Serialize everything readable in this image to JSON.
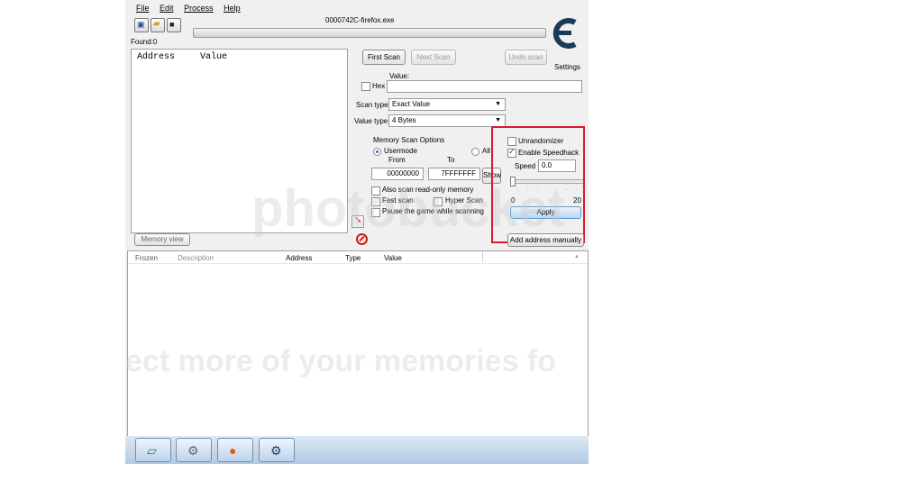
{
  "menu": [
    "File",
    "Edit",
    "Process",
    "Help"
  ],
  "process_title": "0000742C-firefox.exe",
  "found_label": "Found:0",
  "results_list": {
    "headers": [
      "Address",
      "Value"
    ]
  },
  "buttons": {
    "first_scan": "First Scan",
    "next_scan": "Next Scan",
    "undo_scan": "Undo scan",
    "memory_view": "Memory view",
    "show": "Show",
    "apply": "Apply",
    "add_address": "Add address manually"
  },
  "settings_label": "Settings",
  "value_label": "Value:",
  "hex_label": "Hex",
  "scan_type": {
    "label": "Scan type",
    "value": "Exact Value"
  },
  "value_type": {
    "label": "Value type",
    "value": "4 Bytes"
  },
  "memory_scan": {
    "title": "Memory Scan Options",
    "usermode": "Usermode",
    "all": "All",
    "from_label": "From",
    "to_label": "To",
    "from_value": "00000000",
    "to_value": "7FFFFFFF",
    "readonly": "Also scan read-only memory",
    "fast_scan": "Fast scan",
    "hyper_scan": "Hyper Scan",
    "pause": "Pause the game while scanning"
  },
  "speedhack": {
    "unrandomizer": "Unrandomizer",
    "enable": "Enable Speedhack",
    "enabled": true,
    "speed_label": "Speed",
    "speed_value": "0.0",
    "slider_min": "0",
    "slider_max": "20",
    "slider_value": 0
  },
  "address_table": {
    "headers": [
      "Frozen",
      "Description",
      "Address",
      "Type",
      "Value"
    ]
  },
  "taskbar": [
    {
      "name": "show-desktop-icon",
      "glyph": "▱"
    },
    {
      "name": "computer-icon",
      "glyph": "⚙"
    },
    {
      "name": "firefox-icon",
      "glyph": "●"
    },
    {
      "name": "cheat-engine-icon",
      "glyph": "⚙"
    }
  ],
  "watermark": {
    "logo": "photobucket",
    "tagline": "ect more of your memories fo"
  },
  "colors": {
    "highlight": "#e0182d",
    "progress": "#d0d0d0",
    "taskbar": "#bcd2ea",
    "logo": "#1b3a5c"
  }
}
